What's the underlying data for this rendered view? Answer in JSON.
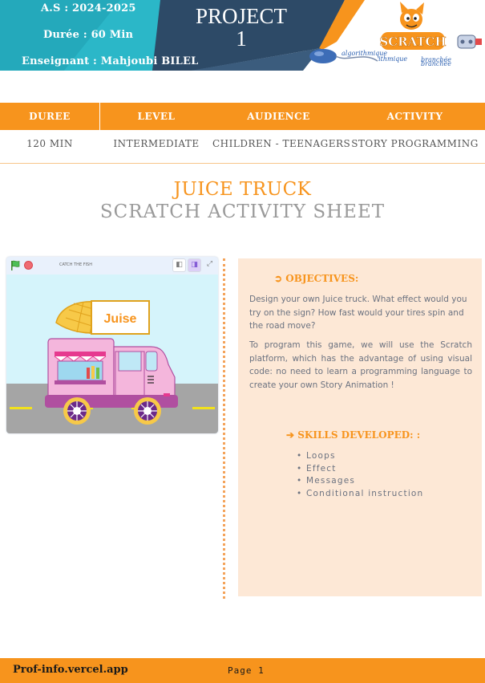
{
  "header": {
    "school_year": "A.S : 2024-2025",
    "duration": "Durée :  60 Min",
    "teacher": "Enseignant   : Mahjoubi BILEL",
    "project_line1": "PROJECT",
    "project_line2": "1",
    "logo_text": "SCRATCH",
    "logo_caption1": "algorithmique",
    "logo_caption2": "branchée",
    "colors": {
      "teal": "#2bb7c8",
      "navy": "#2d4a67",
      "orange": "#f7941d"
    }
  },
  "info": {
    "headers": [
      "DUREE",
      "LEVEL",
      "AUDIENCE",
      "ACTIVITY"
    ],
    "values": [
      "120 MIN",
      "INTERMEDIATE",
      "CHILDREN - TEENAGERS",
      "STORY PROGRAMMING"
    ]
  },
  "title": {
    "line1": "JUICE TRUCK",
    "line2": "SCRATCH ACTIVITY SHEET"
  },
  "stage": {
    "project_name": "CATCH THE FISH",
    "sign_text": "Juise",
    "icons": [
      "green-flag-icon",
      "stop-icon",
      "small-stage-icon",
      "large-stage-icon",
      "fullscreen-icon"
    ]
  },
  "objectives": {
    "title": "OBJECTIVES:",
    "paragraph1": "Design your own Juice truck. What effect would you try on the sign? How fast would your tires spin and the road move?",
    "paragraph2": "To program this game, we will use the Scratch platform, which has the advantage of using visual code: no need to learn a programming language to create your own Story Animation !"
  },
  "skills": {
    "title": "SKILLS DEVELOPED: :",
    "items": [
      "Loops",
      "Effect",
      "Messages",
      "Conditional instruction"
    ]
  },
  "footer": {
    "site": "Prof-info.vercel.app",
    "page": "Page 1"
  }
}
